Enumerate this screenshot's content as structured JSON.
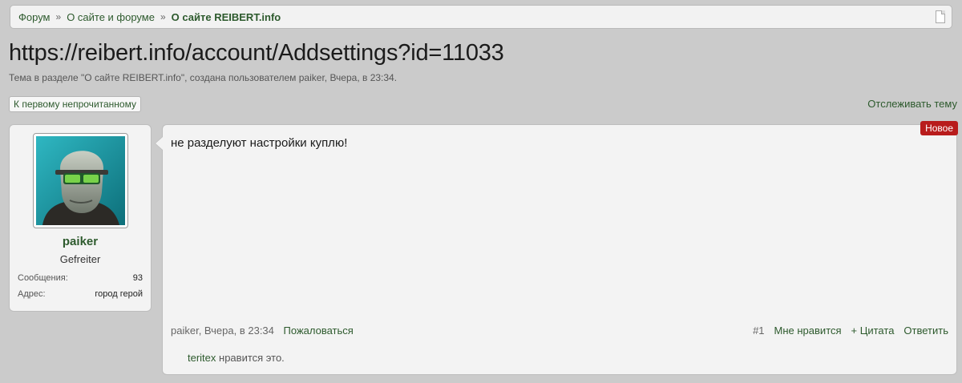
{
  "breadcrumb": {
    "items": [
      "Форум",
      "О сайте и форуме",
      "О сайте REIBERT.info"
    ],
    "separator": "»"
  },
  "thread": {
    "title": "https://reibert.info/account/Addsettings?id=11033",
    "subtitle": "Тема в разделе \"О сайте REIBERT.info\", создана пользователем paiker, Вчера, в 23:34."
  },
  "controls": {
    "unread_button": "К первому непрочитанному",
    "watch_link": "Отслеживать тему"
  },
  "user": {
    "name": "paiker",
    "title": "Gefreiter",
    "messages_label": "Сообщения:",
    "messages_value": "93",
    "address_label": "Адрес:",
    "address_value": "город герой"
  },
  "post": {
    "badge": "Новое",
    "text": "не разделуют настройки куплю!",
    "meta": "paiker, Вчера, в 23:34",
    "report": "Пожаловаться",
    "number": "#1",
    "like": "Мне нравится",
    "quote": "+ Цитата",
    "reply": "Ответить",
    "liker": "teritex",
    "likes_suffix": " нравится это."
  },
  "colors": {
    "link": "#2d5a2d",
    "badge": "#b81c1c",
    "background": "#cbcbcb"
  }
}
